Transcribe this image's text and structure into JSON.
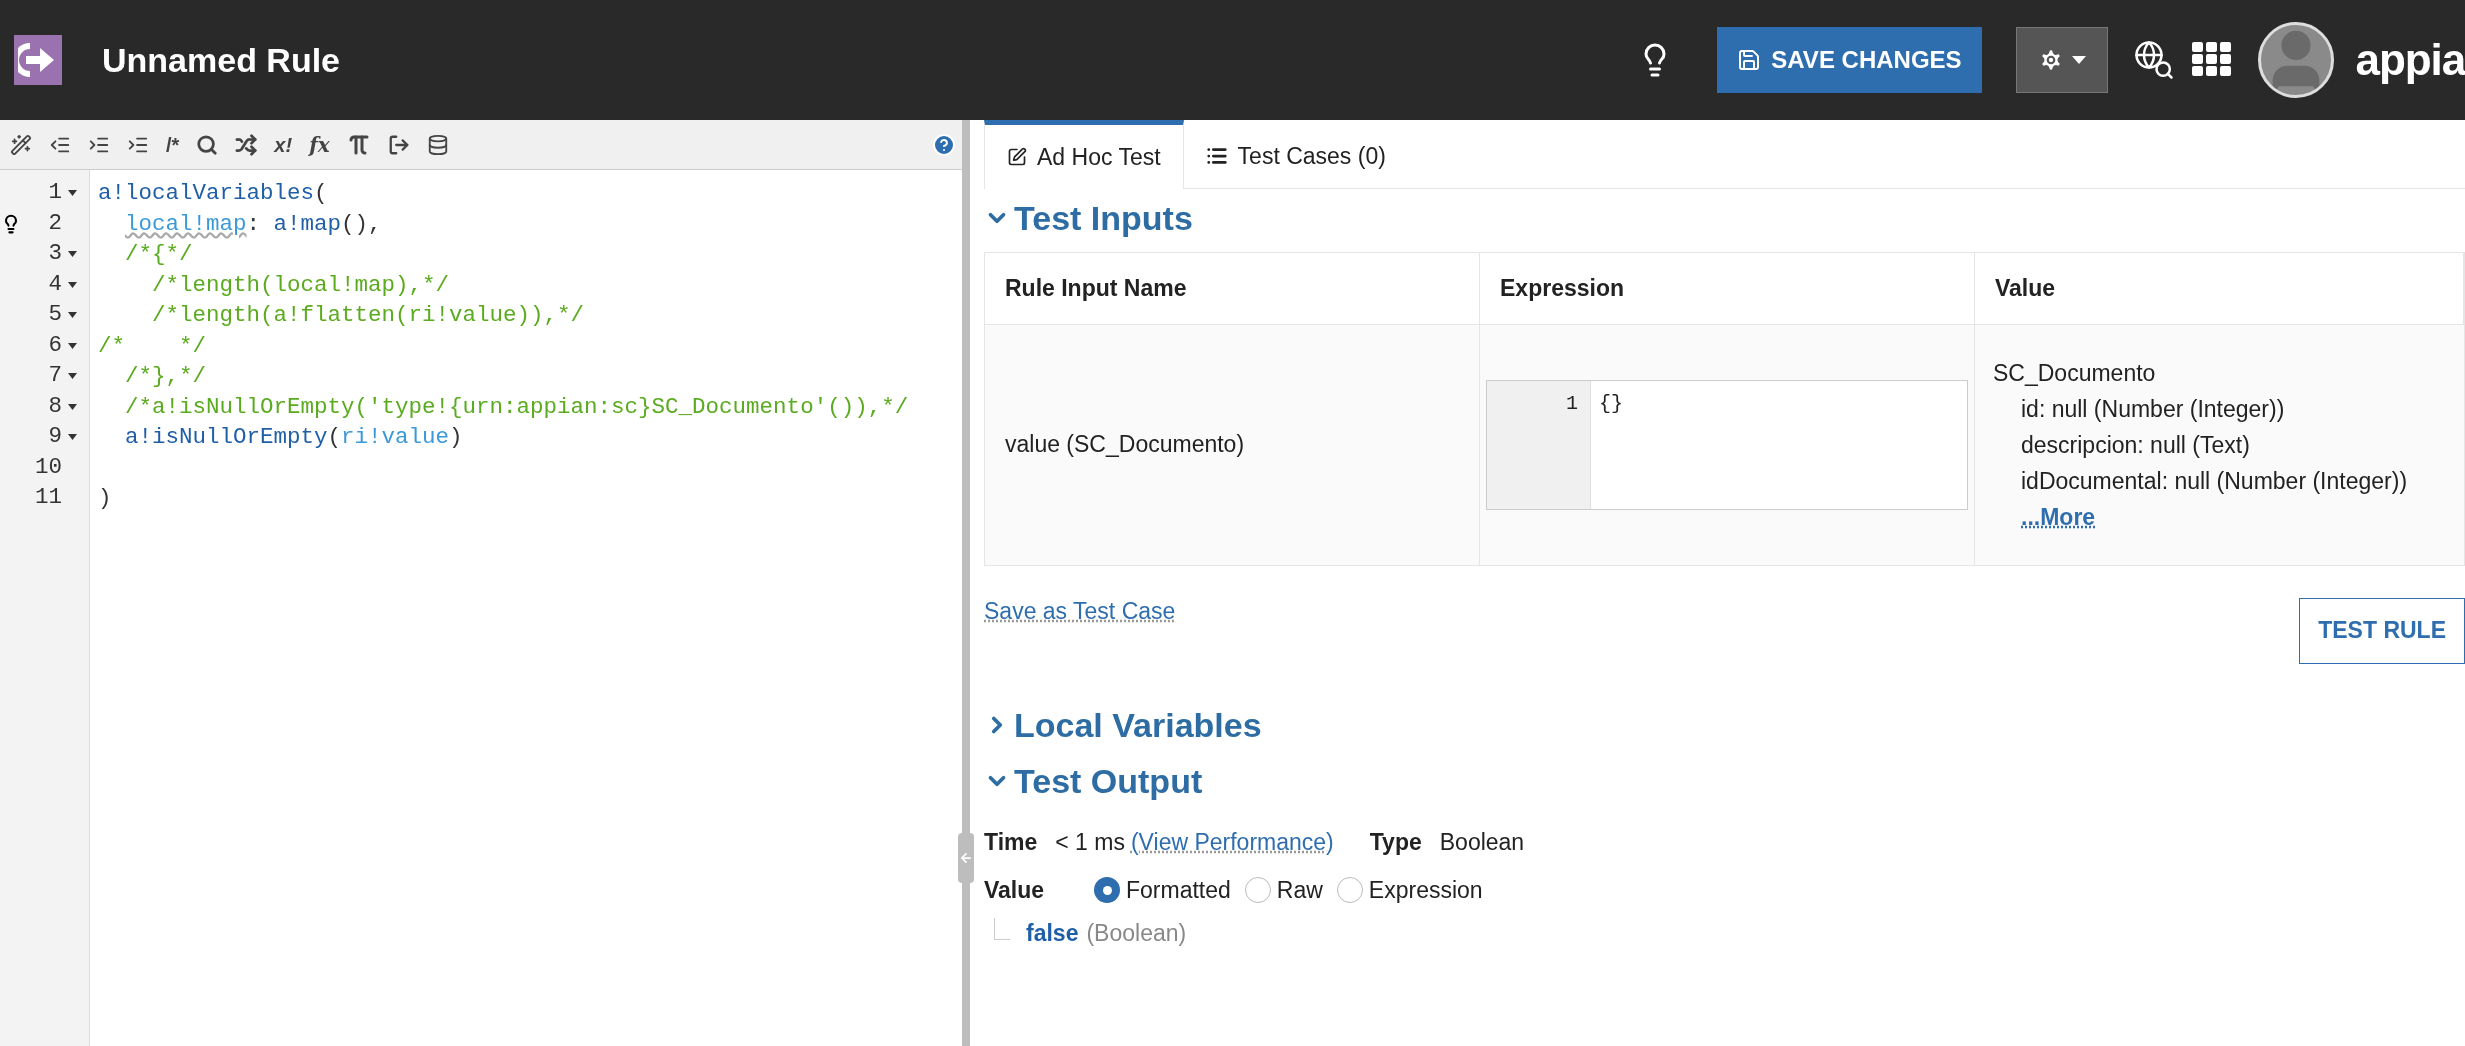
{
  "header": {
    "title": "Unnamed Rule",
    "save_button": "SAVE CHANGES",
    "brand": "appia"
  },
  "toolbar": {
    "comment": "/*",
    "not_null": "x!",
    "function": "fx"
  },
  "code": [
    {
      "number": "1",
      "foldable": true,
      "hint": false,
      "segments": [
        {
          "kind": "fn",
          "text": "a!localVariables"
        },
        {
          "kind": "text",
          "text": "("
        }
      ]
    },
    {
      "number": "2",
      "foldable": false,
      "hint": true,
      "segments": [
        {
          "kind": "flagged",
          "text": "  local!map"
        },
        {
          "kind": "text",
          "text": ": "
        },
        {
          "kind": "fn",
          "text": "a!map"
        },
        {
          "kind": "text",
          "text": "(),"
        }
      ]
    },
    {
      "number": "3",
      "foldable": true,
      "hint": false,
      "segments": [
        {
          "kind": "comment",
          "text": "  /*{*/"
        }
      ]
    },
    {
      "number": "4",
      "foldable": true,
      "hint": false,
      "segments": [
        {
          "kind": "comment",
          "text": "    /*length(local!map),*/"
        }
      ]
    },
    {
      "number": "5",
      "foldable": true,
      "hint": false,
      "segments": [
        {
          "kind": "comment",
          "text": "    /*length(a!flatten(ri!value)),*/"
        }
      ]
    },
    {
      "number": "6",
      "foldable": true,
      "hint": false,
      "segments": [
        {
          "kind": "comment",
          "text": "/*    */"
        }
      ]
    },
    {
      "number": "7",
      "foldable": true,
      "hint": false,
      "segments": [
        {
          "kind": "comment",
          "text": "  /*},*/"
        }
      ]
    },
    {
      "number": "8",
      "foldable": true,
      "hint": false,
      "segments": [
        {
          "kind": "comment",
          "text": "  /*a!isNullOrEmpty('type!{urn:appian:sc}SC_Documento'()),*/"
        }
      ]
    },
    {
      "number": "9",
      "foldable": true,
      "hint": false,
      "segments": [
        {
          "kind": "fn",
          "text": "  a!isNullOrEmpty"
        },
        {
          "kind": "text",
          "text": "("
        },
        {
          "kind": "var",
          "text": "ri!value"
        },
        {
          "kind": "text",
          "text": ")"
        }
      ]
    },
    {
      "number": "10",
      "foldable": false,
      "hint": false
    },
    {
      "number": "11",
      "foldable": false,
      "hint": false,
      "segments": [
        {
          "kind": "text",
          "text": ")"
        }
      ]
    }
  ],
  "tabs": [
    {
      "label": "Ad Hoc Test",
      "selected": true
    },
    {
      "label": "Test Cases (0)",
      "selected": false
    }
  ],
  "test_inputs": {
    "title": "Test Inputs",
    "expanded": true,
    "columns": [
      "Rule Input Name",
      "Expression",
      "Value"
    ],
    "rows": [
      {
        "name": "value (SC_Documento)",
        "expression": {
          "line": "1",
          "text": "{}"
        },
        "value": {
          "type": "SC_Documento",
          "fields": [
            "id: null (Number (Integer))",
            "descripcion: null (Text)",
            "idDocumental: null (Number (Integer))"
          ],
          "more": "...More"
        }
      }
    ]
  },
  "save_test_case": "Save as Test Case",
  "test_rule": "TEST RULE",
  "local_variables": {
    "title": "Local Variables",
    "expanded": false
  },
  "test_output": {
    "title": "Test Output",
    "expanded": true,
    "time_label": "Time",
    "time": "< 1 ms",
    "performance_link": "(View Performance)",
    "type_label": "Type",
    "type": "Boolean",
    "value_label": "Value",
    "options": [
      {
        "label": "Formatted",
        "selected": true
      },
      {
        "label": "Raw",
        "selected": false
      },
      {
        "label": "Expression",
        "selected": false
      }
    ],
    "result": "false",
    "result_type": "(Boolean)"
  }
}
